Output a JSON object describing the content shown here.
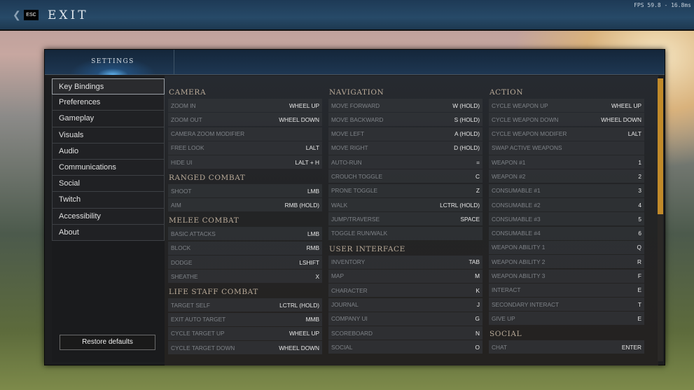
{
  "topbar": {
    "back_icon": "chevron-left-icon",
    "esc_label": "ESC",
    "exit_label": "EXIT",
    "fps": "FPS 59.8 - 16.8ms"
  },
  "panel": {
    "title": "SETTINGS"
  },
  "sidebar": {
    "items": [
      {
        "label": "Key Bindings",
        "active": true
      },
      {
        "label": "Preferences"
      },
      {
        "label": "Gameplay"
      },
      {
        "label": "Visuals"
      },
      {
        "label": "Audio"
      },
      {
        "label": "Communications"
      },
      {
        "label": "Social"
      },
      {
        "label": "Twitch"
      },
      {
        "label": "Accessibility"
      },
      {
        "label": "About"
      }
    ],
    "restore_label": "Restore defaults"
  },
  "scrollbar": {
    "accent": "#c18a2a",
    "position_fraction": 0.0,
    "visible_fraction": 0.48
  },
  "columns": [
    [
      {
        "title": "CAMERA",
        "rows": [
          [
            "ZOOM IN",
            "WHEEL UP"
          ],
          [
            "ZOOM OUT",
            "WHEEL DOWN"
          ],
          [
            "CAMERA ZOOM MODIFIER",
            ""
          ],
          [
            "FREE LOOK",
            "LALT"
          ],
          [
            "HIDE UI",
            "LALT + H"
          ]
        ]
      },
      {
        "title": "RANGED COMBAT",
        "rows": [
          [
            "SHOOT",
            "LMB"
          ],
          [
            "AIM",
            "RMB (HOLD)"
          ]
        ]
      },
      {
        "title": "MELEE COMBAT",
        "rows": [
          [
            "BASIC ATTACKS",
            "LMB"
          ],
          [
            "BLOCK",
            "RMB"
          ],
          [
            "DODGE",
            "LSHIFT"
          ],
          [
            "SHEATHE",
            "X"
          ]
        ]
      },
      {
        "title": "LIFE STAFF COMBAT",
        "rows": [
          [
            "TARGET SELF",
            "LCTRL (HOLD)"
          ],
          [
            "EXIT AUTO TARGET",
            "MMB"
          ],
          [
            "CYCLE TARGET UP",
            "WHEEL UP"
          ],
          [
            "CYCLE TARGET DOWN",
            "WHEEL DOWN"
          ]
        ]
      }
    ],
    [
      {
        "title": "NAVIGATION",
        "rows": [
          [
            "MOVE FORWARD",
            "W (HOLD)"
          ],
          [
            "MOVE BACKWARD",
            "S (HOLD)"
          ],
          [
            "MOVE LEFT",
            "A (HOLD)"
          ],
          [
            "MOVE RIGHT",
            "D (HOLD)"
          ],
          [
            "AUTO-RUN",
            "="
          ],
          [
            "CROUCH TOGGLE",
            "C"
          ],
          [
            "PRONE TOGGLE",
            "Z"
          ],
          [
            "WALK",
            "LCTRL (HOLD)"
          ],
          [
            "JUMP/TRAVERSE",
            "SPACE"
          ],
          [
            "TOGGLE RUN/WALK",
            ""
          ]
        ]
      },
      {
        "title": "USER INTERFACE",
        "rows": [
          [
            "INVENTORY",
            "TAB"
          ],
          [
            "MAP",
            "M"
          ],
          [
            "CHARACTER",
            "K"
          ],
          [
            "JOURNAL",
            "J"
          ],
          [
            "COMPANY UI",
            "G"
          ],
          [
            "SCOREBOARD",
            "N"
          ],
          [
            "SOCIAL",
            "O"
          ]
        ]
      }
    ],
    [
      {
        "title": "ACTION",
        "rows": [
          [
            "CYCLE WEAPON UP",
            "WHEEL UP"
          ],
          [
            "CYCLE WEAPON DOWN",
            "WHEEL DOWN"
          ],
          [
            "CYCLE WEAPON MODIFER",
            "LALT"
          ],
          [
            "SWAP ACTIVE WEAPONS",
            ""
          ],
          [
            "WEAPON #1",
            "1"
          ],
          [
            "WEAPON #2",
            "2"
          ],
          [
            "CONSUMABLE #1",
            "3"
          ],
          [
            "CONSUMABLE #2",
            "4"
          ],
          [
            "CONSUMABLE #3",
            "5"
          ],
          [
            "CONSUMABLE #4",
            "6"
          ],
          [
            "WEAPON ABILITY 1",
            "Q"
          ],
          [
            "WEAPON ABILITY 2",
            "R"
          ],
          [
            "WEAPON ABILITY 3",
            "F"
          ],
          [
            "INTERACT",
            "E"
          ],
          [
            "SECONDARY INTERACT",
            "T"
          ],
          [
            "GIVE UP",
            "E"
          ]
        ]
      },
      {
        "title": "SOCIAL",
        "rows": [
          [
            "CHAT",
            "ENTER"
          ]
        ]
      }
    ]
  ]
}
